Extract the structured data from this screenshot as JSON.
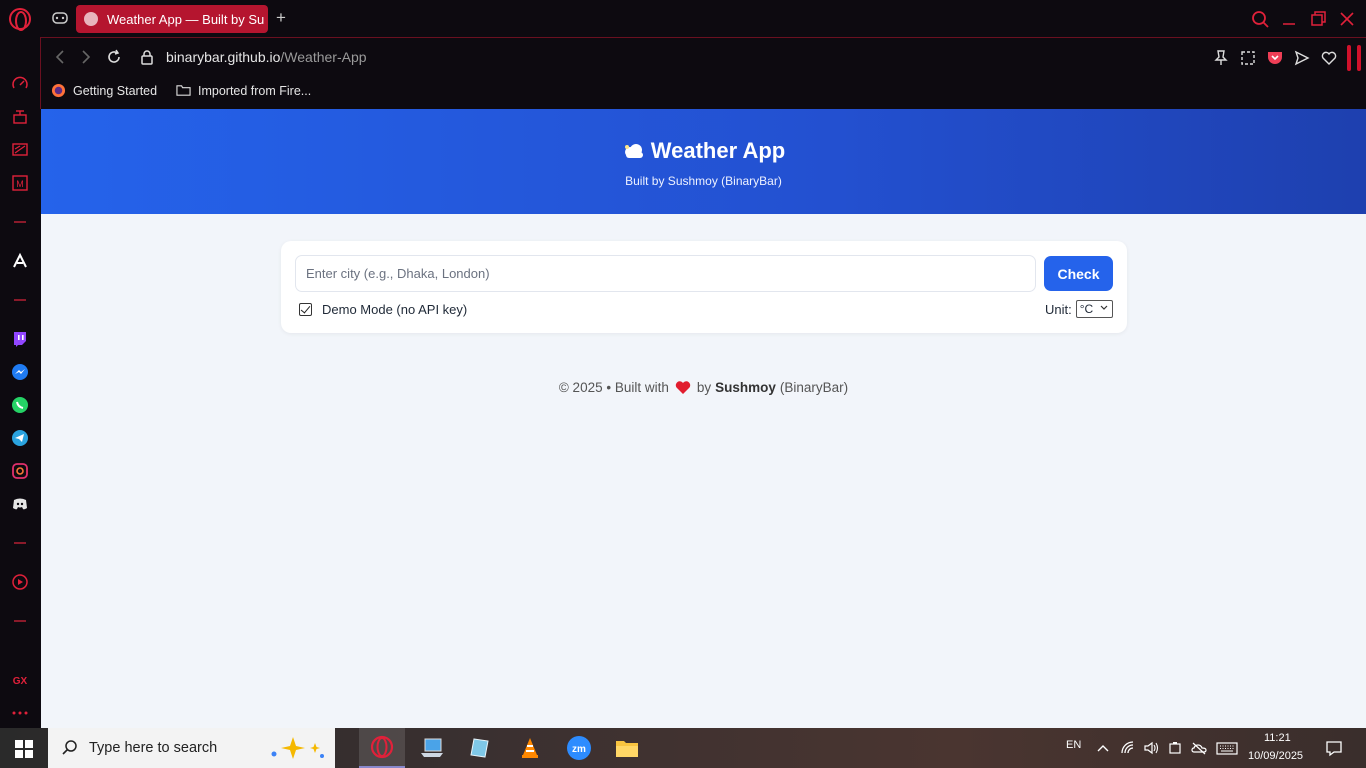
{
  "browser": {
    "tab_title": "Weather App — Built by Su",
    "url_host": "binarybar.github.io",
    "url_path": "/Weather-App",
    "bookmarks": [
      {
        "label": "Getting Started",
        "icon": "firefox-icon"
      },
      {
        "label": "Imported from Fire...",
        "icon": "folder-icon"
      }
    ],
    "accent": "#d0112b"
  },
  "app": {
    "title": "Weather App",
    "subtitle": "Built by Sushmoy (BinaryBar)",
    "search_placeholder": "Enter city (e.g., Dhaka, London)",
    "search_value": "",
    "check_label": "Check",
    "demo_label": "Demo Mode (no API key)",
    "demo_checked": true,
    "unit_label": "Unit:",
    "unit_value": "°C",
    "footer_prefix": "© 2025 • Built with",
    "footer_by": "by",
    "footer_author": "Sushmoy",
    "footer_suffix": "(BinaryBar)",
    "primary_color": "#2563eb"
  },
  "taskbar": {
    "search_text": "Type here to search",
    "language": "EN",
    "time": "11:21",
    "date": "10/09/2025"
  }
}
